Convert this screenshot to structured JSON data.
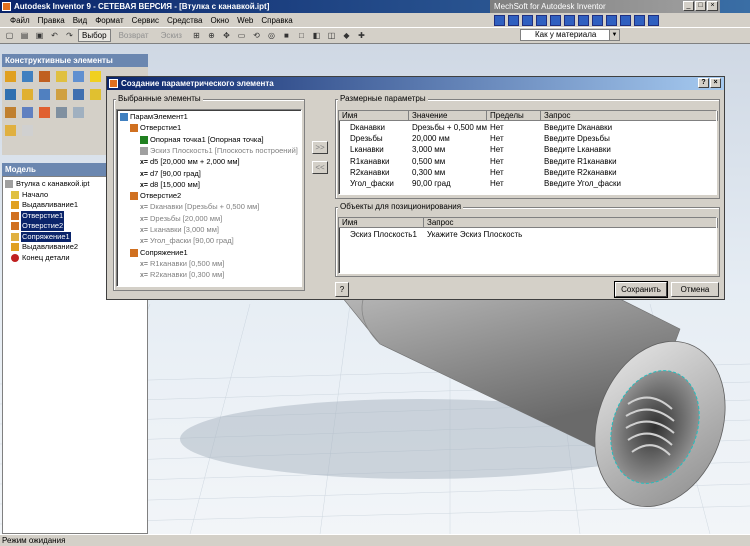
{
  "window": {
    "title": "Autodesk Inventor 9 - СЕТЕВАЯ ВЕРСИЯ - [Втулка с канавкой.ipt]",
    "mechsoft_title": "MechSoft for Autodesk Inventor"
  },
  "menu": [
    "Файл",
    "Правка",
    "Вид",
    "Формат",
    "Сервис",
    "Средства",
    "Окно",
    "Web",
    "Справка"
  ],
  "toolbar": {
    "select_label": "Выбор",
    "return_label": "Возврат",
    "sketch_label": "Эскиз",
    "material": "Как у материала"
  },
  "panels": {
    "features_title": "Конструктивные элементы",
    "model_title": "Модель"
  },
  "tree": [
    {
      "label": "Втулка с канавкой.ipt",
      "selected": false,
      "level": 0
    },
    {
      "label": "Начало",
      "selected": false,
      "level": 1
    },
    {
      "label": "Выдавливание1",
      "selected": false,
      "level": 1
    },
    {
      "label": "Отверстие1",
      "selected": true,
      "level": 1
    },
    {
      "label": "Отверстие2",
      "selected": true,
      "level": 1
    },
    {
      "label": "Сопряжение1",
      "selected": true,
      "level": 1
    },
    {
      "label": "Выдавливание2",
      "selected": false,
      "level": 1
    },
    {
      "label": "Конец детали",
      "selected": false,
      "level": 1
    }
  ],
  "dialog": {
    "title": "Создание параметрического элемента",
    "selected_group": "Выбранные элементы",
    "params_group": "Размерные параметры",
    "positioning_group": "Объекты для позиционирования",
    "save_label": "Сохранить",
    "cancel_label": "Отмена",
    "help_label": "?",
    "add_arrow": ">>",
    "remove_arrow": "<<"
  },
  "selected_tree": [
    {
      "text": "ПарамЭлемент1",
      "indent": 0,
      "dim": false,
      "kind": "root"
    },
    {
      "text": "Отверстие1",
      "indent": 1,
      "dim": false,
      "kind": "feature"
    },
    {
      "text": "Опорная точка1 [Опорная точка]",
      "indent": 2,
      "dim": false,
      "kind": "point"
    },
    {
      "text": "Эскиз Плоскость1 [Плоскость построений]",
      "indent": 2,
      "dim": true,
      "kind": "plane"
    },
    {
      "text": "d5 [20,000 мм + 2,000 мм]",
      "indent": 2,
      "dim": false,
      "kind": "x"
    },
    {
      "text": "d7 [90,00 град]",
      "indent": 2,
      "dim": false,
      "kind": "x"
    },
    {
      "text": "d8 [15,000 мм]",
      "indent": 2,
      "dim": false,
      "kind": "x"
    },
    {
      "text": "Отверстие2",
      "indent": 1,
      "dim": false,
      "kind": "feature"
    },
    {
      "text": "Dканавки [Dрезьбы + 0,500 мм]",
      "indent": 2,
      "dim": true,
      "kind": "x"
    },
    {
      "text": "Dрезьбы [20,000 мм]",
      "indent": 2,
      "dim": true,
      "kind": "x"
    },
    {
      "text": "Lканавки [3,000 мм]",
      "indent": 2,
      "dim": true,
      "kind": "x"
    },
    {
      "text": "Угол_фаски [90,00 град]",
      "indent": 2,
      "dim": true,
      "kind": "x"
    },
    {
      "text": "Сопряжение1",
      "indent": 1,
      "dim": false,
      "kind": "feature"
    },
    {
      "text": "R1канавки [0,500 мм]",
      "indent": 2,
      "dim": true,
      "kind": "x"
    },
    {
      "text": "R2канавки [0,300 мм]",
      "indent": 2,
      "dim": true,
      "kind": "x"
    }
  ],
  "params_headers": [
    "Имя",
    "Значение",
    "Пределы",
    "Запрос"
  ],
  "params_rows": [
    [
      "Dканавки",
      "Dрезьбы + 0,500 мм",
      "Нет",
      "Введите Dканавки"
    ],
    [
      "Dрезьбы",
      "20,000 мм",
      "Нет",
      "Введите Dрезьбы"
    ],
    [
      "Lканавки",
      "3,000 мм",
      "Нет",
      "Введите Lканавки"
    ],
    [
      "R1канавки",
      "0,500 мм",
      "Нет",
      "Введите R1канавки"
    ],
    [
      "R2канавки",
      "0,300 мм",
      "Нет",
      "Введите R2канавки"
    ],
    [
      "Угол_фаски",
      "90,00 град",
      "Нет",
      "Введите Угол_фаски"
    ]
  ],
  "pos_headers": [
    "Имя",
    "Запрос"
  ],
  "pos_rows": [
    [
      "Эскиз Плоскость1",
      "Укажите Эскиз Плоскость"
    ]
  ],
  "status": "Режим ожидания"
}
